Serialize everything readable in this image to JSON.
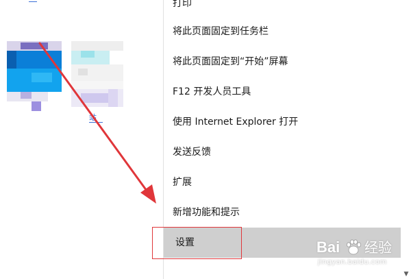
{
  "menu": {
    "items": [
      {
        "label": "打印"
      },
      {
        "label": "将此页面固定到任务栏"
      },
      {
        "label": "将此页面固定到“开始”屏幕"
      },
      {
        "label": "F12 开发人员工具"
      },
      {
        "label": "使用 Internet Explorer 打开"
      },
      {
        "label": "发送反馈"
      },
      {
        "label": "扩展"
      },
      {
        "label": "新增功能和提示"
      },
      {
        "label": "设置"
      }
    ],
    "selected_index": 8
  },
  "thumbnail_caption": "站",
  "watermark": {
    "brand": "Bai",
    "brand_suffix": "经验",
    "url": "jingyan.baidu.com"
  },
  "colors": {
    "annotation_red": "#e0363a",
    "selected_bg": "#cfcfcf",
    "link_blue": "#3b6fd6"
  },
  "icons": {
    "scroll_down": "chevron-down-icon",
    "watermark_paw": "baidu-paw-icon"
  }
}
